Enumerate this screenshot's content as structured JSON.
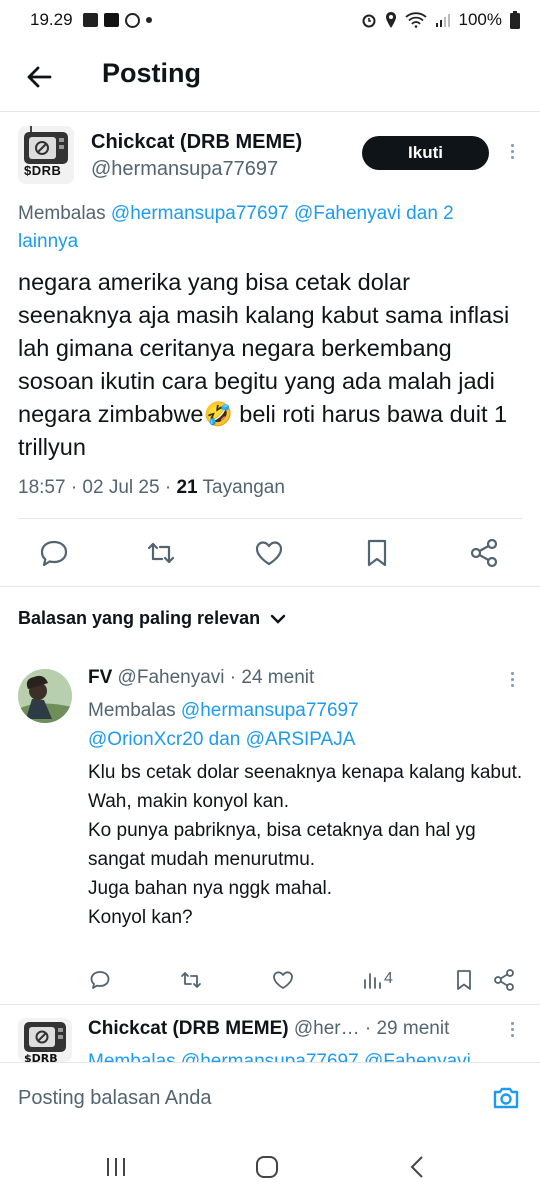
{
  "status_bar": {
    "time": "19.29",
    "battery": "100%"
  },
  "header": {
    "title": "Posting"
  },
  "main_post": {
    "author_name": "Chickcat (DRB MEME)",
    "author_handle": "@hermansupa77697",
    "follow_label": "Ikuti",
    "reply_prefix": "Membalas ",
    "reply_mentions": "@hermansupa77697 @Fahenyavi",
    "reply_suffix": " dan 2 lainnya",
    "text": "negara amerika yang bisa cetak dolar seenaknya aja masih kalang kabut sama inflasi lah gimana ceritanya negara berkembang sosoan ikutin cara begitu yang ada malah jadi negara zimbabwe🤣 beli roti harus bawa duit 1 trillyun",
    "time": "18:57 · 02 Jul 25 · ",
    "views": "21",
    "views_label": " Tayangan",
    "avatar_label": "$DRB"
  },
  "sort": {
    "label": "Balasan yang paling relevan"
  },
  "reply1": {
    "name": "FV",
    "handle_time": " @Fahenyavi · 24 menit",
    "reply_prefix": "Membalas ",
    "mention1": "@hermansupa77697",
    "mention2": "@OrionXcr20",
    "mention_join": " dan ",
    "mention3": "@ARSIPAJA",
    "lines": [
      "Klu bs cetak dolar seenaknya kenapa kalang kabut.",
      "Wah, makin konyol kan.",
      "Ko punya pabriknya, bisa cetaknya dan hal yg sangat mudah menurutmu.",
      "Juga bahan nya nggk mahal.",
      "Konyol kan?"
    ],
    "view_count": "4"
  },
  "reply2": {
    "name": "Chickcat (DRB MEME)",
    "handle": " @her…",
    "time": " · 29 menit",
    "reply_preview": "Membalas @hermansupa77697 @Fahenyavi"
  },
  "composer": {
    "placeholder": "Posting balasan Anda"
  },
  "colors": {
    "accent": "#1d9bf0",
    "text": "#0f1419",
    "muted": "#536471"
  }
}
